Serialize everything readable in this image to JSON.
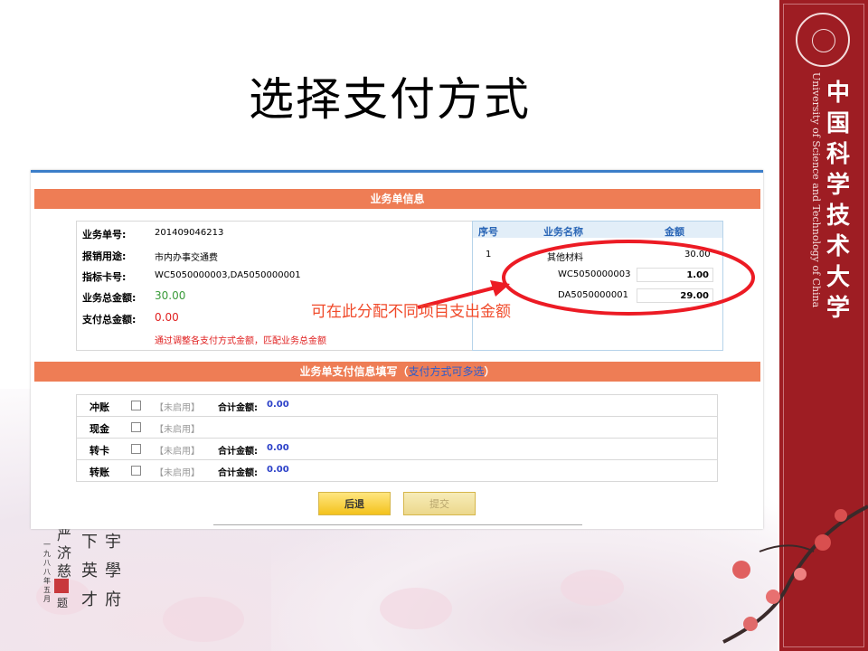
{
  "slide": {
    "title": "选择支付方式"
  },
  "sidebar": {
    "univ_cn": [
      "中",
      "国",
      "科",
      "学",
      "技",
      "术",
      "大",
      "学"
    ],
    "univ_en": "University of Science and Technology of China"
  },
  "order": {
    "header": "业务单信息",
    "labels": {
      "id": "业务单号:",
      "purpose": "报销用途:",
      "card": "指标卡号:",
      "total": "业务总金额:",
      "pay_total": "支付总金额:"
    },
    "id": "201409046213",
    "purpose": "市内办事交通费",
    "card": "WC5050000003,DA5050000001",
    "total": "30.00",
    "pay_total": "0.00",
    "note": "通过调整各支付方式金额，匹配业务总金额"
  },
  "items_table": {
    "headers": [
      "序号",
      "业务名称",
      "金额"
    ],
    "row": {
      "no": "1",
      "name": "其他材料",
      "amount": "30.00"
    },
    "subrows": [
      {
        "code": "WC5050000003",
        "value": "1.00"
      },
      {
        "code": "DA5050000001",
        "value": "29.00"
      }
    ]
  },
  "annotation": "可在此分配不同项目支出金额",
  "payment": {
    "header_prefix": "业务单支付信息填写（",
    "header_link": "支付方式可多选",
    "header_suffix": "）",
    "total_label": "合计金额:",
    "disabled_tag": "【未启用】",
    "methods": [
      {
        "name": "冲账",
        "total": "0.00"
      },
      {
        "name": "现金"
      },
      {
        "name": "转卡",
        "total": "0.00"
      },
      {
        "name": "转账",
        "total": "0.00"
      }
    ]
  },
  "buttons": {
    "back": "后退",
    "submit": "提交"
  },
  "calligraphy": {
    "cols": [
      "严济慈",
      "下英才",
      "宇學府"
    ],
    "date": "一九八八年五月",
    "sig": "题"
  },
  "colors": {
    "accent": "#ee7d55",
    "sidebar": "#9e1d23",
    "annotation": "#f04a2a"
  }
}
